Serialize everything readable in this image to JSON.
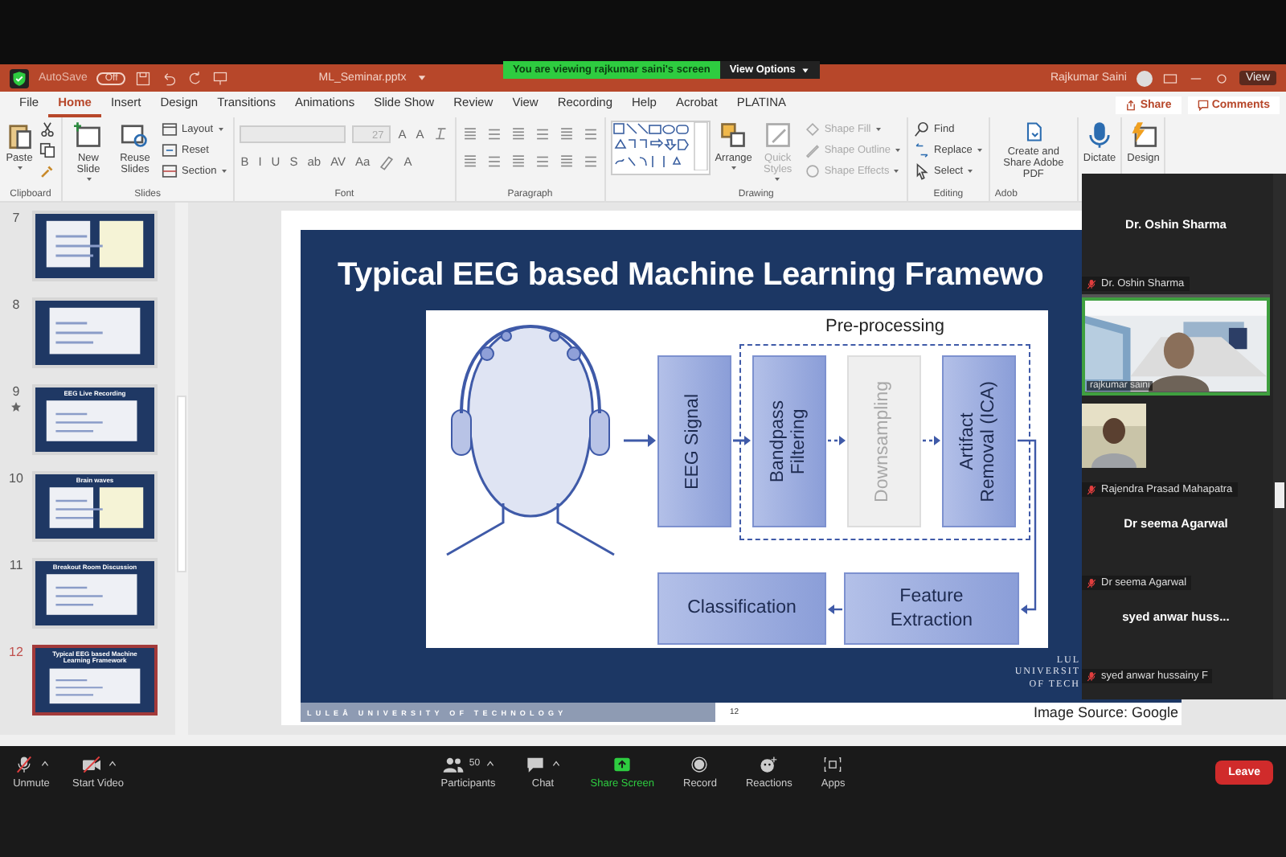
{
  "title_bar": {
    "autosave_label": "AutoSave",
    "autosave_state": "Off",
    "file_name": "ML_Seminar.pptx",
    "user": "Rajkumar Saini",
    "view_label": "View"
  },
  "share_banner": {
    "message": "You are viewing rajkumar saini's screen",
    "view_options": "View Options"
  },
  "ribbon_tabs": [
    {
      "label": "File",
      "selected": false
    },
    {
      "label": "Home",
      "selected": true
    },
    {
      "label": "Insert",
      "selected": false
    },
    {
      "label": "Design",
      "selected": false
    },
    {
      "label": "Transitions",
      "selected": false
    },
    {
      "label": "Animations",
      "selected": false
    },
    {
      "label": "Slide Show",
      "selected": false
    },
    {
      "label": "Review",
      "selected": false
    },
    {
      "label": "View",
      "selected": false
    },
    {
      "label": "Recording",
      "selected": false
    },
    {
      "label": "Help",
      "selected": false
    },
    {
      "label": "Acrobat",
      "selected": false
    },
    {
      "label": "PLATINA",
      "selected": false
    }
  ],
  "share_button": "Share",
  "comments_button": "Comments",
  "ribbon_groups": [
    {
      "label": "Clipboard",
      "items": [
        {
          "kind": "large",
          "label": "Paste",
          "caret": true,
          "disabled": false
        },
        {
          "kind": "icon"
        },
        {
          "kind": "icon"
        },
        {
          "kind": "icon"
        }
      ]
    },
    {
      "label": "Slides",
      "items": [
        {
          "kind": "large",
          "label": "New Slide",
          "caret": true,
          "disabled": false
        },
        {
          "kind": "large",
          "label": "Reuse Slides",
          "caret": false,
          "disabled": false
        },
        {
          "kind": "small",
          "label": "Layout",
          "caret": true,
          "disabled": false
        },
        {
          "kind": "small",
          "label": "Reset",
          "caret": false,
          "disabled": false
        },
        {
          "kind": "small",
          "label": "Section",
          "caret": true,
          "disabled": false
        }
      ]
    },
    {
      "label": "Font",
      "rows": [
        [
          {
            "kind": "combo",
            "wide": true,
            "disabled": true
          },
          {
            "kind": "combo",
            "value": "27",
            "disabled": true
          },
          {
            "kind": "glyph",
            "label": "A"
          },
          {
            "kind": "glyph",
            "label": "A"
          },
          {
            "kind": "icon"
          }
        ],
        [
          {
            "kind": "glyph",
            "label": "B"
          },
          {
            "kind": "glyph",
            "label": "I"
          },
          {
            "kind": "glyph",
            "label": "U"
          },
          {
            "kind": "glyph",
            "label": "S"
          },
          {
            "kind": "glyph",
            "label": "ab"
          },
          {
            "kind": "glyph",
            "label": "AV"
          },
          {
            "kind": "glyph",
            "label": "Aa"
          },
          {
            "kind": "icon"
          },
          {
            "kind": "glyph",
            "label": "A"
          }
        ]
      ]
    },
    {
      "label": "Paragraph",
      "rows": [
        [
          {
            "kind": "icon"
          },
          {
            "kind": "icon"
          },
          {
            "kind": "icon"
          },
          {
            "kind": "icon"
          },
          {
            "kind": "icon"
          },
          {
            "kind": "icon"
          }
        ],
        [
          {
            "kind": "icon"
          },
          {
            "kind": "icon"
          },
          {
            "kind": "icon"
          },
          {
            "kind": "icon"
          },
          {
            "kind": "icon"
          },
          {
            "kind": "icon"
          }
        ]
      ]
    },
    {
      "label": "Drawing",
      "items": [
        {
          "kind": "gallery"
        },
        {
          "kind": "large",
          "label": "Arrange",
          "caret": true,
          "disabled": false
        },
        {
          "kind": "large",
          "label": "Quick Styles",
          "caret": true,
          "disabled": true
        },
        {
          "kind": "small",
          "label": "Shape Fill",
          "caret": true,
          "disabled": true
        },
        {
          "kind": "small",
          "label": "Shape Outline",
          "caret": true,
          "disabled": true
        },
        {
          "kind": "small",
          "label": "Shape Effects",
          "caret": true,
          "disabled": true
        }
      ]
    },
    {
      "label": "Editing",
      "items": [
        {
          "kind": "small",
          "label": "Find",
          "caret": false,
          "disabled": false
        },
        {
          "kind": "small",
          "label": "Replace",
          "caret": true,
          "disabled": false
        },
        {
          "kind": "small",
          "label": "Select",
          "caret": true,
          "disabled": false
        }
      ]
    },
    {
      "label": "Adob",
      "items": [
        {
          "kind": "large",
          "label": "Create and Share Adobe PDF",
          "caret": false,
          "disabled": false
        }
      ]
    },
    {
      "items": [
        {
          "kind": "large",
          "label": "Dictate",
          "caret": false,
          "disabled": false
        }
      ]
    },
    {
      "items": [
        {
          "kind": "large",
          "label": "Design",
          "caret": false,
          "disabled": false
        }
      ]
    }
  ],
  "thumbnails": [
    {
      "number": "7",
      "selected": false,
      "starred": false
    },
    {
      "number": "8",
      "selected": false,
      "starred": false
    },
    {
      "number": "9",
      "title": "EEG Live Recording",
      "selected": false,
      "starred": true
    },
    {
      "number": "10",
      "title": "Brain waves",
      "selected": false,
      "starred": false
    },
    {
      "number": "11",
      "title": "Breakout Room Discussion",
      "selected": false,
      "starred": false
    },
    {
      "number": "12",
      "title": "Typical EEG based Machine Learning Framework",
      "selected": true,
      "starred": false
    }
  ],
  "slide": {
    "title": "Typical EEG based Machine Learning Framewo",
    "input_step": {
      "label": "EEG Signal"
    },
    "preprocessing": {
      "label": "Pre-processing",
      "steps": [
        {
          "label": "Bandpass\nFiltering",
          "faded": false
        },
        {
          "label": "Downsampling",
          "faded": true
        },
        {
          "label": "Artifact\nRemoval (ICA)",
          "faded": false
        }
      ]
    },
    "outputs": [
      {
        "label": "Classification"
      },
      {
        "label": "Feature\nExtraction"
      }
    ],
    "logo_lines": [
      "LUL",
      "UNIVERSIT",
      "OF TECH"
    ],
    "footer_text": "LULEÅ UNIVERSITY OF TECHNOLOGY",
    "slide_number": "12",
    "image_source": "Image Source: Google"
  },
  "participants": [
    {
      "kind": "name",
      "display_name": "Dr. Oshin Sharma",
      "label": "Dr. Oshin Sharma",
      "muted": true
    },
    {
      "kind": "video",
      "label": "rajkumar saini",
      "speaking": true
    },
    {
      "label": "Rajendra Prasad Mahapatra",
      "muted": true
    },
    {
      "kind": "name",
      "display_name": "Dr seema Agarwal",
      "label": "Dr seema Agarwal",
      "muted": true
    },
    {
      "kind": "name",
      "display_name": "syed anwar huss...",
      "label": "syed anwar hussainy F",
      "muted": true
    }
  ],
  "toolbar": {
    "left": [
      {
        "kind": "mic",
        "label": "Unmute",
        "caret": true
      },
      {
        "kind": "video",
        "label": "Start Video",
        "caret": true
      }
    ],
    "center": [
      {
        "kind": "participants",
        "label": "Participants",
        "count": "50",
        "caret": true
      },
      {
        "kind": "chat",
        "label": "Chat",
        "caret": true
      },
      {
        "kind": "share",
        "label": "Share Screen",
        "caret": false
      },
      {
        "kind": "record",
        "label": "Record",
        "caret": false
      },
      {
        "kind": "reactions",
        "label": "Reactions",
        "caret": false
      },
      {
        "kind": "apps",
        "label": "Apps",
        "caret": false
      }
    ],
    "leave": "Leave"
  }
}
